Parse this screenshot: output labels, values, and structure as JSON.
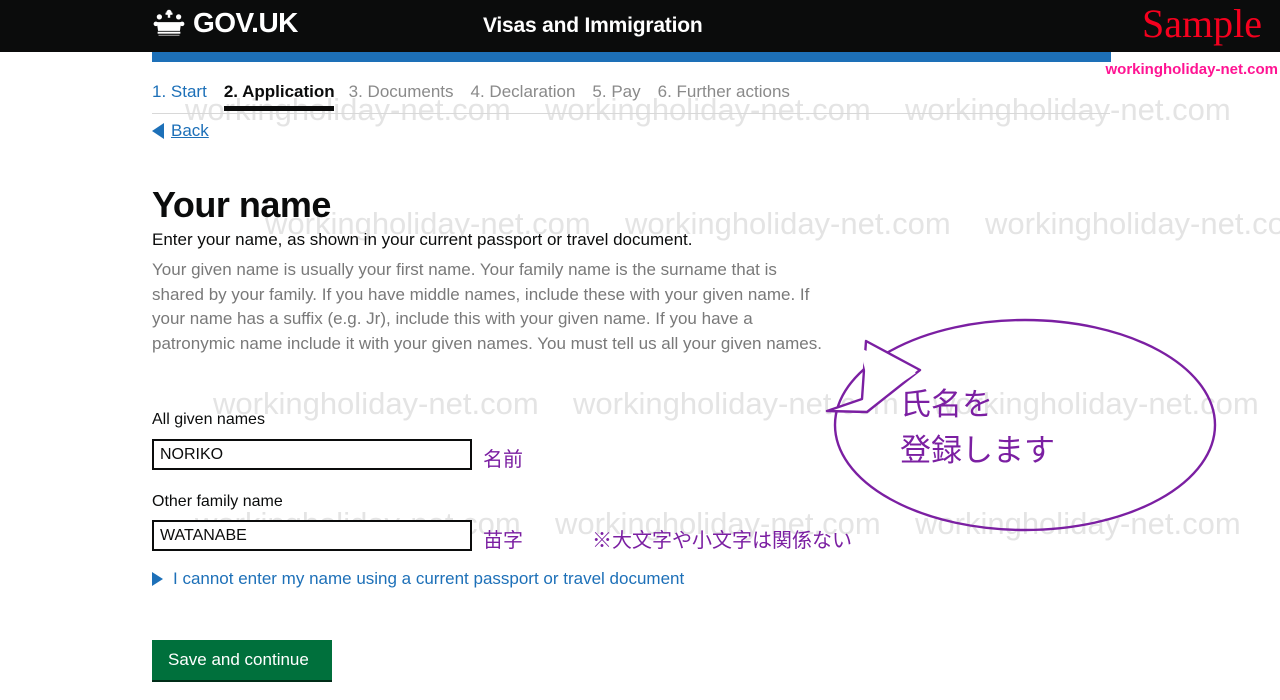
{
  "header": {
    "brand": "GOV.UK",
    "crown_icon": "crown-icon",
    "service_name": "Visas and Immigration",
    "sample_watermark": "Sample",
    "site_watermark": "workingholiday-net.com",
    "accent_blue": "#1d70b8",
    "header_black": "#0b0c0c",
    "sample_red": "#f5001e",
    "site_pink": "#ff1493"
  },
  "phase_nav": {
    "steps": [
      {
        "label": "1. Start",
        "state": "link"
      },
      {
        "label": "2. Application",
        "state": "current"
      },
      {
        "label": "3. Documents",
        "state": "muted"
      },
      {
        "label": "4. Declaration",
        "state": "muted"
      },
      {
        "label": "5. Pay",
        "state": "muted"
      },
      {
        "label": "6. Further actions",
        "state": "muted"
      }
    ]
  },
  "back": {
    "label": "Back",
    "icon": "left-triangle-icon"
  },
  "main": {
    "title": "Your name",
    "lede": "Enter your name, as shown in your current passport or travel document.",
    "paragraph": "Your given name is usually your first name. Your family name is the surname that is shared by your family. If you have middle names, include these with your given name. If your name has a suffix (e.g. Jr), include this with your given name. If you have a patronymic name include it with your given names. You must tell us all your given names."
  },
  "form": {
    "given_names": {
      "label": "All given names",
      "value": "NORIKO",
      "placeholder": "",
      "annotation": "名前"
    },
    "family_name": {
      "label": "Other family name",
      "value": "WATANABE",
      "placeholder": "",
      "annotation": "苗字",
      "extra_note": "※大文字や小文字は関係ない"
    }
  },
  "details": {
    "label": "I cannot enter my name using a current passport or travel document",
    "icon": "right-triangle-icon"
  },
  "actions": {
    "save_label": "Save and continue",
    "button_green": "#00703c"
  },
  "callout": {
    "text": "氏名を\n登録します",
    "color": "#7b1fa2"
  },
  "watermark": {
    "text": "workingholiday-net.com",
    "color": "#e4e4e4"
  }
}
